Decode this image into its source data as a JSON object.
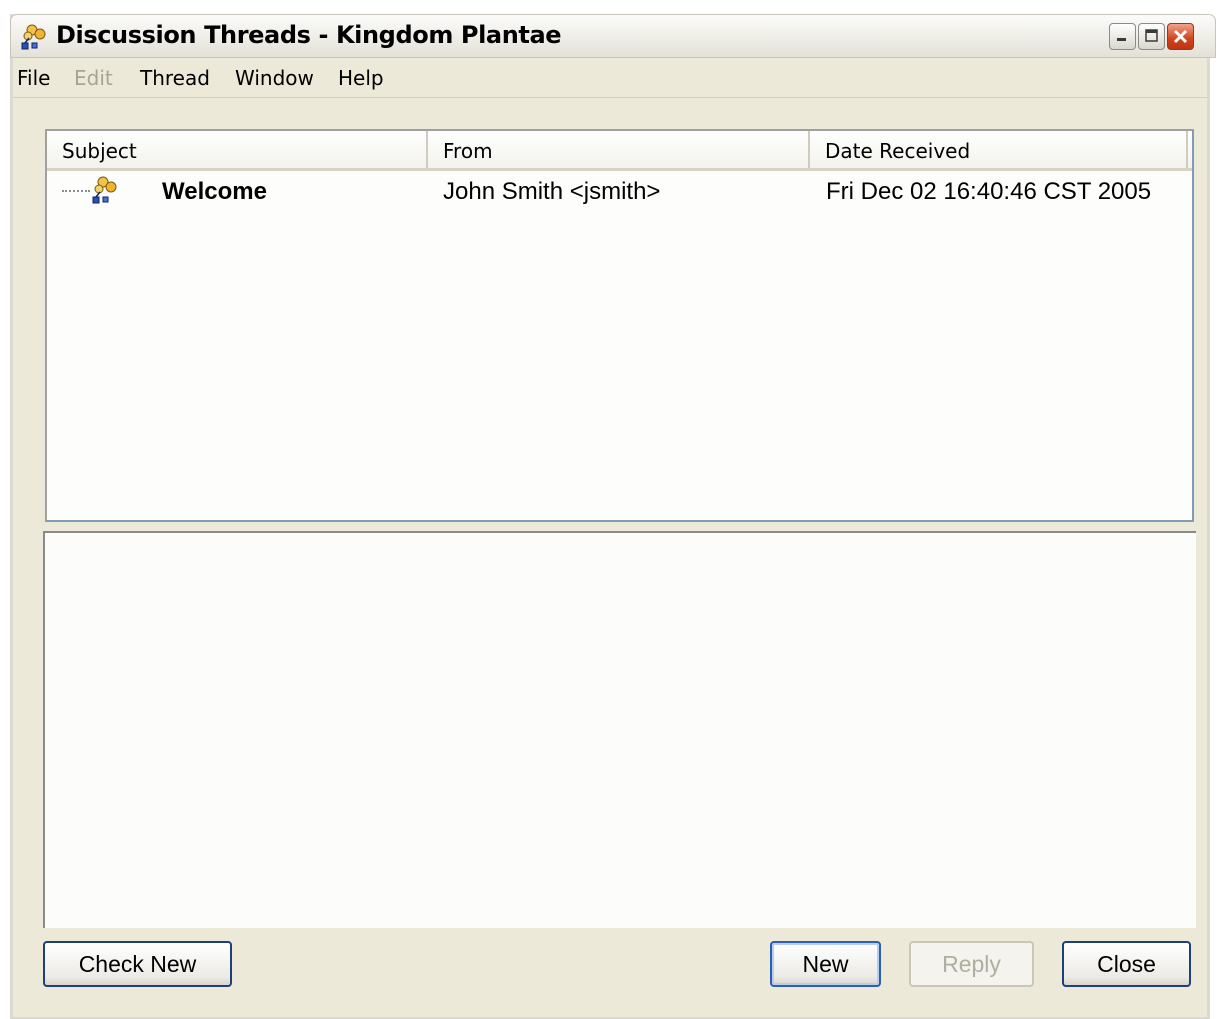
{
  "window": {
    "title": "Discussion Threads - Kingdom Plantae",
    "icon": "discussion-threads-icon",
    "controls": [
      "minimize-icon",
      "maximize-icon",
      "close-icon"
    ]
  },
  "menu": {
    "file": "File",
    "edit": "Edit",
    "thread": "Thread",
    "window": "Window",
    "help": "Help"
  },
  "table": {
    "columns": [
      "Subject",
      "From",
      "Date Received"
    ],
    "rows": [
      {
        "icon": "thread-icon",
        "subject": "Welcome",
        "from": "John Smith <jsmith>",
        "date": "Fri Dec 02 16:40:46 CST 2005"
      }
    ]
  },
  "buttons": {
    "check_new": "Check New",
    "new": "New",
    "reply": "Reply",
    "close": "Close"
  },
  "colors": {
    "window_bg": "#ece9d8",
    "list_bg": "#fdfdfb",
    "default_button_border": "#2d5fb0",
    "disabled_text": "#a7a592"
  }
}
